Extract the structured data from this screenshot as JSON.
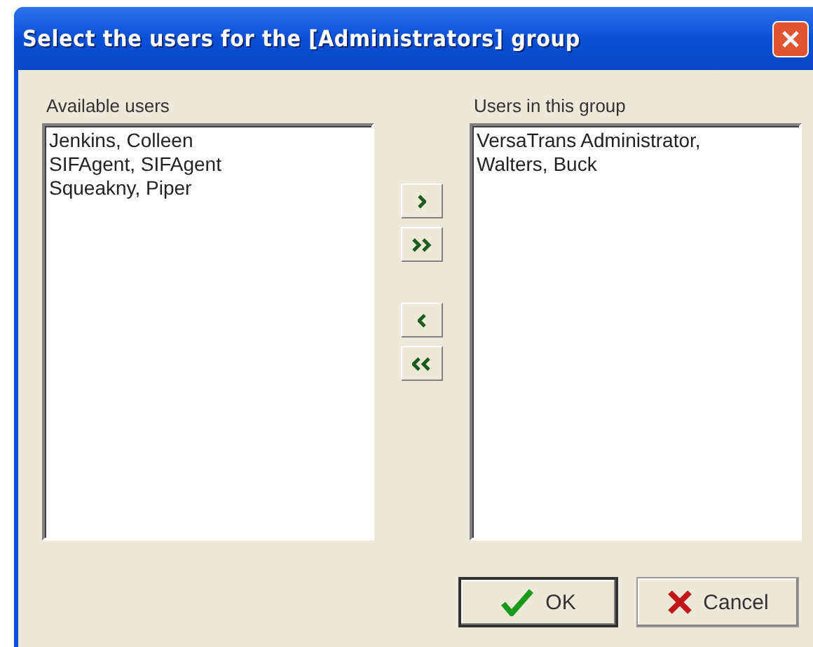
{
  "window": {
    "title": "Select the users for the [Administrators] group"
  },
  "available": {
    "label": "Available users",
    "items": [
      {
        "name": "Jenkins, Colleen"
      },
      {
        "name": "SIFAgent, SIFAgent"
      },
      {
        "name": "Squeakny, Piper"
      }
    ]
  },
  "members": {
    "label": "Users in this group",
    "items": [
      {
        "name": "VersaTrans Administrator,"
      },
      {
        "name": "Walters, Buck"
      }
    ]
  },
  "move_buttons": [
    {
      "kind": "add"
    },
    {
      "kind": "add_all"
    },
    {
      "kind": "remove"
    },
    {
      "kind": "remove_all"
    }
  ],
  "buttons": [
    {
      "kind": "ok",
      "label": "OK"
    },
    {
      "kind": "cancel",
      "label": "Cancel"
    }
  ]
}
